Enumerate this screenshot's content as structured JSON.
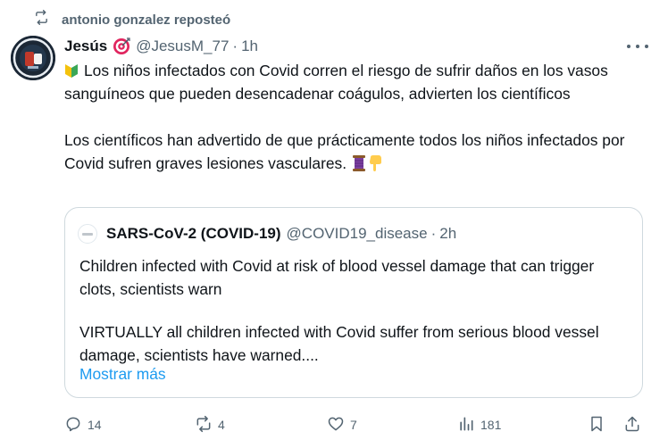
{
  "repost": {
    "text": "antonio gonzalez reposteó",
    "icon": "repost-icon"
  },
  "tweet": {
    "display_name": "Jesús",
    "handle": "@JesusM_77",
    "separator": "·",
    "time": "1h",
    "paragraph_1": "Los niños infectados con Covid corren el riesgo de sufrir daños en los vasos sanguíneos que pueden desencadenar coágulos, advierten los científicos",
    "paragraph_2": "Los científicos han advertido de que prácticamente todos los niños infectados por Covid sufren graves lesiones vasculares."
  },
  "quote": {
    "display_name": "SARS-CoV-2 (COVID-19)",
    "handle": "@COVID19_disease",
    "separator": "·",
    "time": "2h",
    "paragraph_1": "Children infected with Covid at risk of blood vessel damage that can trigger clots, scientists warn",
    "paragraph_2": "VIRTUALLY all children infected with Covid suffer from serious blood vessel damage, scientists have warned....",
    "show_more": "Mostrar más"
  },
  "actions": {
    "replies": "14",
    "reposts": "4",
    "likes": "7",
    "views": "181"
  },
  "colors": {
    "text": "#0f1419",
    "muted": "#536471",
    "link": "#1d9bf0",
    "border": "#cfd9de"
  }
}
